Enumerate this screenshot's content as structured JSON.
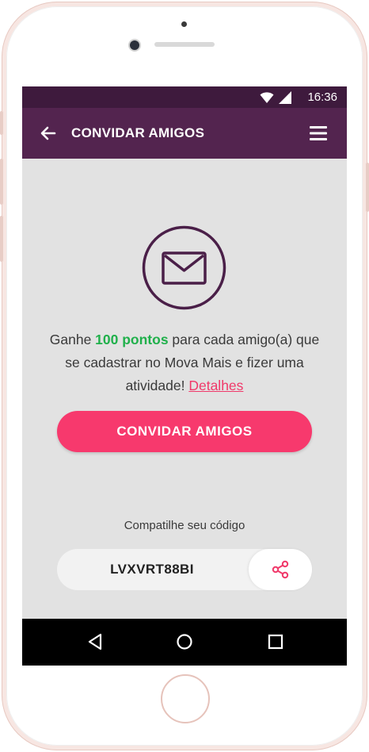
{
  "status_bar": {
    "time": "16:36"
  },
  "app_bar": {
    "title": "CONVIDAR AMIGOS"
  },
  "promo": {
    "text_before": "Ganhe ",
    "highlight": "100 pontos",
    "text_after": " para cada amigo(a) que se cadastrar no Mova Mais e fizer uma atividade! ",
    "link": "Detalhes"
  },
  "invite_button": {
    "label": "CONVIDAR AMIGOS"
  },
  "share": {
    "label": "Compatilhe seu código",
    "code": "LVXVRT88BI"
  },
  "colors": {
    "status_bar": "#3e1a3d",
    "app_bar": "#53244f",
    "accent_pink": "#f7396d",
    "highlight_green": "#20b04b",
    "icon_purple": "#4a1f48"
  },
  "icons": [
    "wifi-icon",
    "signal-icon",
    "back-arrow-icon",
    "hamburger-menu-icon",
    "envelope-icon",
    "share-icon",
    "nav-back-icon",
    "nav-home-icon",
    "nav-recents-icon"
  ]
}
